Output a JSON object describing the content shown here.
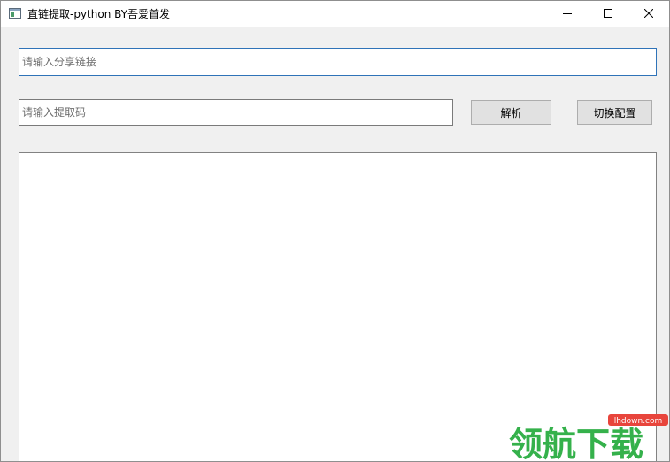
{
  "window": {
    "title": "直链提取-python BY吾爱首发"
  },
  "form": {
    "link_placeholder": "请输入分享链接",
    "link_value": "",
    "code_placeholder": "请输入提取码",
    "code_value": "",
    "parse_label": "解析",
    "config_label": "切换配置"
  },
  "output": {
    "text": ""
  },
  "watermark": {
    "brand": "领航下载",
    "site": "lhdown.com"
  },
  "colors": {
    "accent_border": "#2f73b8",
    "watermark_green": "#35b14b",
    "watermark_red": "#e8453c"
  },
  "icons": {
    "app": "app-window-icon",
    "minimize": "minimize-icon",
    "maximize": "maximize-icon",
    "close": "close-icon"
  }
}
